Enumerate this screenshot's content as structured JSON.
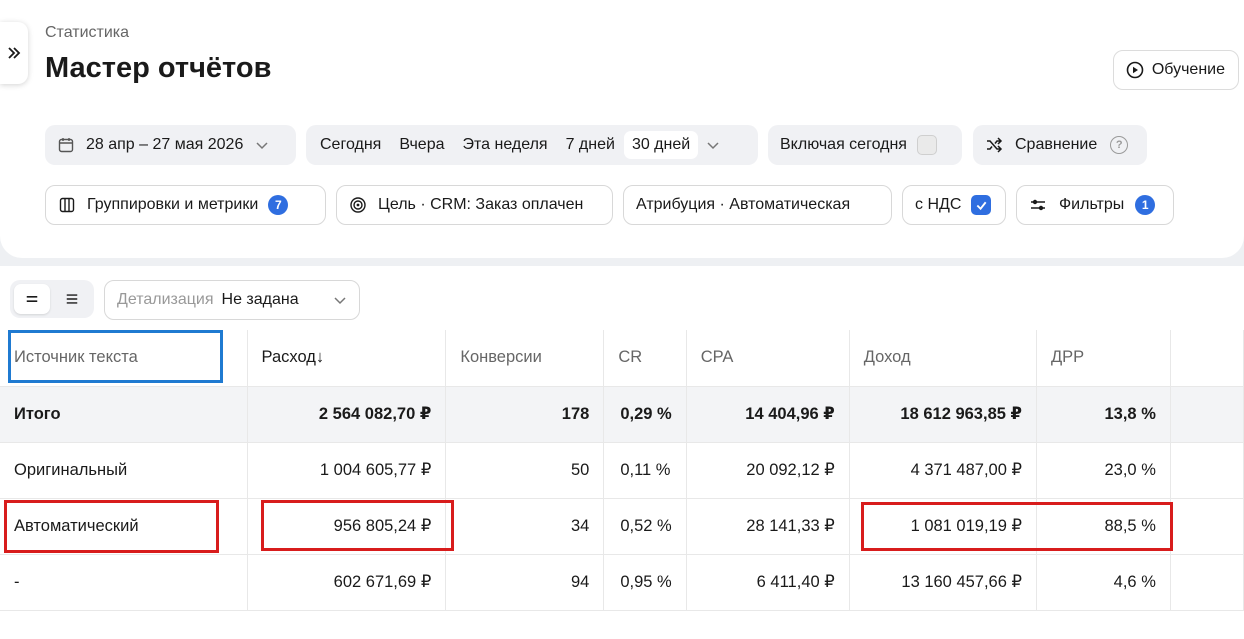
{
  "header": {
    "breadcrumb": "Статистика",
    "title": "Мастер отчётов",
    "learn_label": "Обучение"
  },
  "filters": {
    "date_range": "28 апр – 27 мая 2026",
    "periods": [
      "Сегодня",
      "Вчера",
      "Эта неделя",
      "7 дней",
      "30 дней"
    ],
    "active_period": "30 дней",
    "include_today_label": "Включая сегодня",
    "include_today_checked": false,
    "compare_label": "Сравнение",
    "help_glyph": "?",
    "groupings_label": "Группировки и метрики",
    "groupings_count": "7",
    "goal_label": "Цель · CRM: Заказ оплачен",
    "attribution_label": "Атрибуция · Автоматическая",
    "vat_label": "с НДС",
    "vat_checked": true,
    "filters_label": "Фильтры",
    "filters_count": "1"
  },
  "view": {
    "detail_label": "Детализация",
    "detail_value": "Не задана"
  },
  "table": {
    "columns": [
      "Источник текста",
      "Расход↓",
      "Конверсии",
      "CR",
      "CPA",
      "Доход",
      "ДРР"
    ],
    "total": [
      "Итого",
      "2 564 082,70 ₽",
      "178",
      "0,29 %",
      "14 404,96 ₽",
      "18 612 963,85 ₽",
      "13,8 %"
    ],
    "rows": [
      [
        "Оригинальный",
        "1 004 605,77 ₽",
        "50",
        "0,11 %",
        "20 092,12 ₽",
        "4 371 487,00 ₽",
        "23,0 %"
      ],
      [
        "Автоматический",
        "956 805,24 ₽",
        "34",
        "0,52 %",
        "28 141,33 ₽",
        "1 081 019,19 ₽",
        "88,5 %"
      ],
      [
        "-",
        "602 671,69 ₽",
        "94",
        "0,95 %",
        "6 411,40 ₽",
        "13 160 457,66 ₽",
        "4,6 %"
      ]
    ]
  },
  "colors": {
    "accent_blue": "#2f6ee0",
    "highlight_blue": "#1f7ad1",
    "highlight_red": "#d81c1c"
  }
}
